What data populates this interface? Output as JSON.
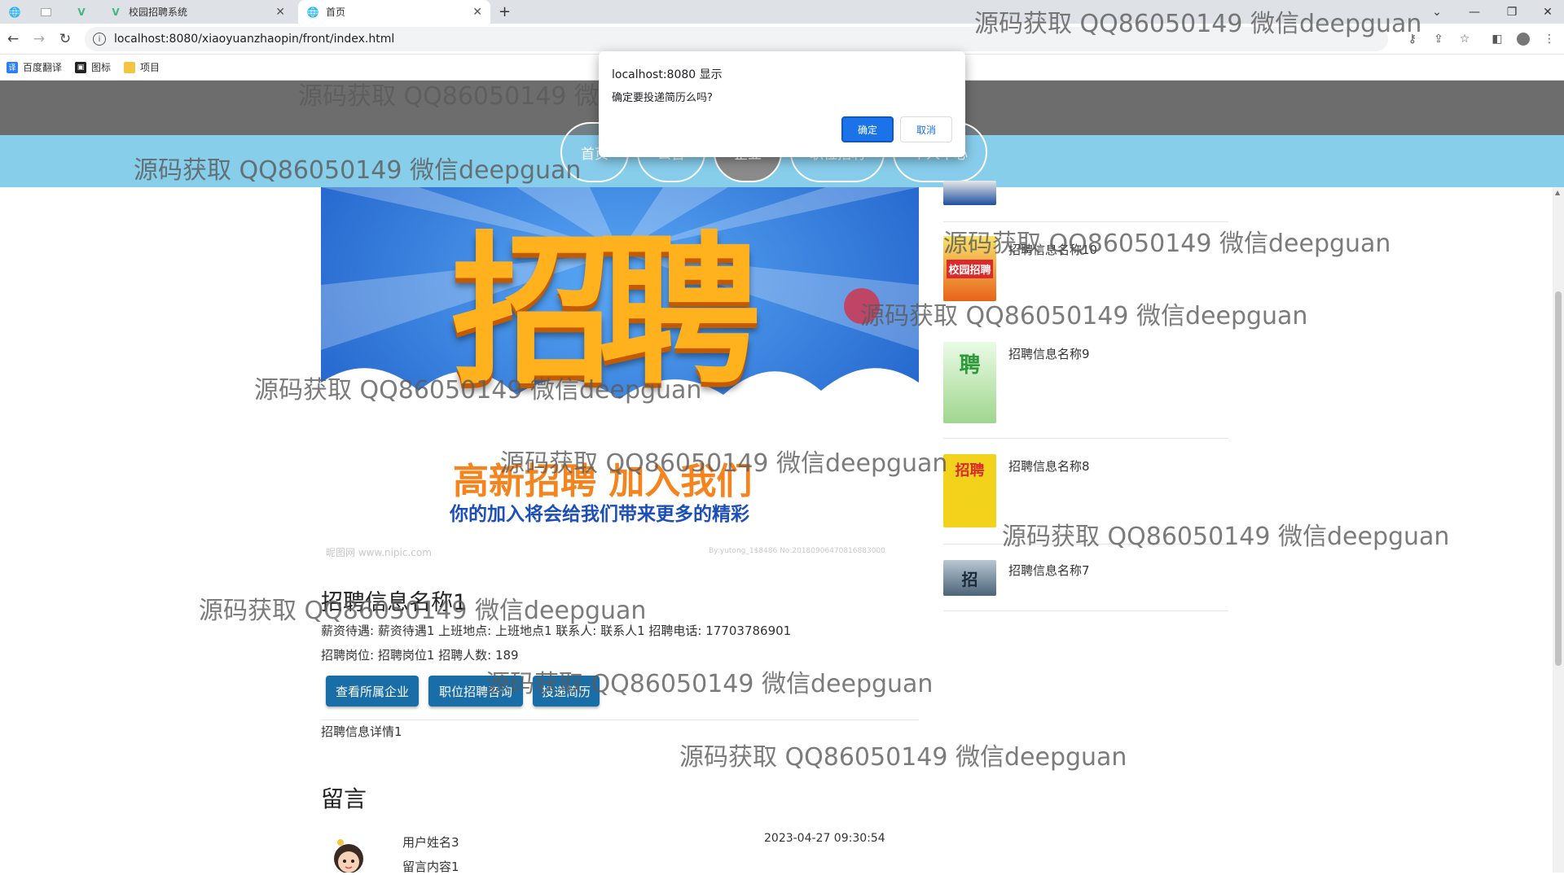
{
  "browser": {
    "tabs": [
      {
        "title": "",
        "icon": "globe-icon"
      },
      {
        "title": "",
        "icon": "blank-page-icon"
      },
      {
        "title": "",
        "icon": "vue-icon"
      },
      {
        "title": "校园招聘系统",
        "icon": "vue-icon"
      },
      {
        "title": "首页",
        "icon": "globe-icon"
      }
    ],
    "url": "localhost:8080/xiaoyuanzhaopin/front/index.html",
    "bookmarks": [
      {
        "label": "百度翻译",
        "icon": "translate-icon"
      },
      {
        "label": "图标",
        "icon": "icon-folder-icon"
      },
      {
        "label": "项目",
        "icon": "folder-icon"
      }
    ]
  },
  "nav": {
    "items": [
      "首页",
      "公告",
      "企业",
      "职位招聘",
      "个人中心"
    ],
    "selected": "企业"
  },
  "banner": {
    "headline": "招聘",
    "slogan": "高新招聘 加入我们",
    "subslogan": "你的加入将会给我们带来更多的精彩",
    "site_mark": "昵图网 www.nipic.com",
    "id_mark": "By:yutong_1$8486 No:20180906470816883000"
  },
  "job": {
    "title": "招聘信息名称1",
    "row1": "薪资待遇:  薪资待遇1   上班地点:  上班地点1   联系人:  联系人1   招聘电话:  17703786901",
    "row2": "招聘岗位:  招聘岗位1   招聘人数:  189",
    "buttons": [
      "查看所属企业",
      "职位招聘咨询",
      "投递简历"
    ],
    "detail": "招聘信息详情1"
  },
  "messages": {
    "heading": "留言",
    "items": [
      {
        "user": "用户姓名3",
        "content": "留言内容1",
        "time": "2023-04-27 09:30:54"
      }
    ]
  },
  "sidebar": {
    "items": [
      {
        "name": "招聘信息名称10",
        "thumb_text": "校园招聘"
      },
      {
        "name": "招聘信息名称9",
        "thumb_text": "聘"
      },
      {
        "name": "招聘信息名称8",
        "thumb_text": "招聘"
      },
      {
        "name": "招聘信息名称7",
        "thumb_text": "招"
      }
    ]
  },
  "dialog": {
    "title": "localhost:8080 显示",
    "message": "确定要投递简历么吗?",
    "ok": "确定",
    "cancel": "取消"
  },
  "watermark": "源码获取 QQ86050149 微信deepguan",
  "colors": {
    "header_gray": "#6d6d6d",
    "nav_blue": "#87ceeb",
    "button_blue": "#1a6ea8",
    "dialog_blue": "#1a73e8"
  }
}
